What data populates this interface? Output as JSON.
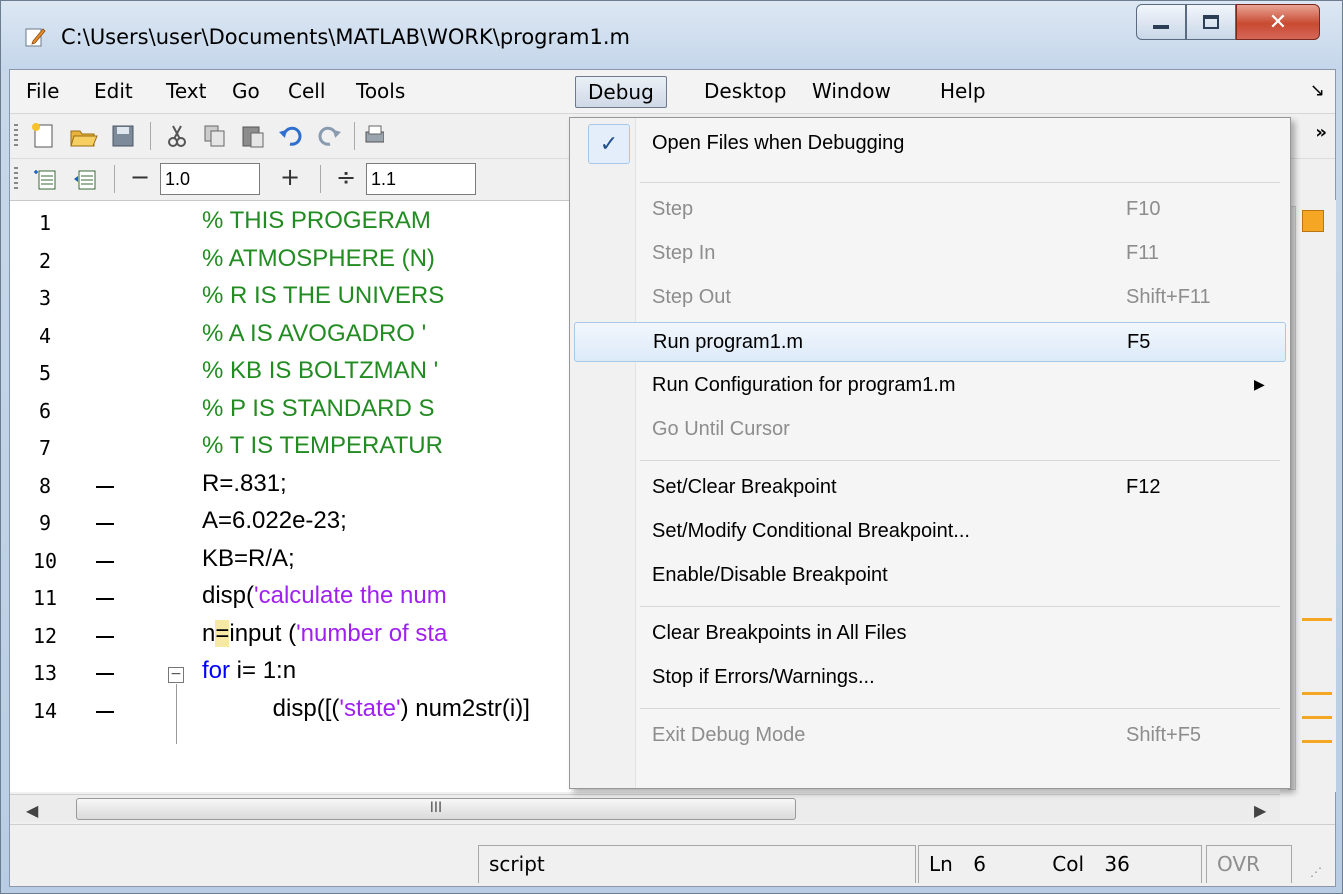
{
  "window": {
    "title": "C:\\Users\\user\\Documents\\MATLAB\\WORK\\program1.m"
  },
  "menubar": {
    "items": [
      "File",
      "Edit",
      "Text",
      "Go",
      "Cell",
      "Tools",
      "Debug",
      "Desktop",
      "Window",
      "Help"
    ],
    "open_menu": "Debug"
  },
  "toolbar2": {
    "value1": "1.0",
    "value2": "1.1"
  },
  "editor": {
    "lines": [
      {
        "num": "1",
        "dash": false,
        "segments": [
          {
            "t": "% THIS PROGERAM ",
            "c": "comment"
          }
        ]
      },
      {
        "num": "2",
        "dash": false,
        "segments": [
          {
            "t": "% ATMOSPHERE (N)",
            "c": "comment"
          }
        ]
      },
      {
        "num": "3",
        "dash": false,
        "segments": [
          {
            "t": "% R IS THE UNIVERS",
            "c": "comment"
          }
        ]
      },
      {
        "num": "4",
        "dash": false,
        "segments": [
          {
            "t": "% A IS AVOGADRO '",
            "c": "comment"
          }
        ]
      },
      {
        "num": "5",
        "dash": false,
        "segments": [
          {
            "t": "% KB IS BOLTZMAN '",
            "c": "comment"
          }
        ]
      },
      {
        "num": "6",
        "dash": false,
        "segments": [
          {
            "t": "% P IS STANDARD S",
            "c": "comment"
          }
        ]
      },
      {
        "num": "7",
        "dash": false,
        "segments": [
          {
            "t": "% T IS TEMPERATUR",
            "c": "comment"
          }
        ]
      },
      {
        "num": "8",
        "dash": true,
        "segments": [
          {
            "t": "R=.831;",
            "c": "normal"
          }
        ]
      },
      {
        "num": "9",
        "dash": true,
        "segments": [
          {
            "t": "A=6.022e-23;",
            "c": "normal"
          }
        ]
      },
      {
        "num": "10",
        "dash": true,
        "segments": [
          {
            "t": "KB=R/A;",
            "c": "normal"
          }
        ]
      },
      {
        "num": "11",
        "dash": true,
        "segments": [
          {
            "t": "disp(",
            "c": "normal"
          },
          {
            "t": "'calculate the num",
            "c": "string"
          }
        ]
      },
      {
        "num": "12",
        "dash": true,
        "segments": [
          {
            "t": "n",
            "c": "normal"
          },
          {
            "t": "=",
            "c": "cursor"
          },
          {
            "t": "input (",
            "c": "normal"
          },
          {
            "t": "'number of sta",
            "c": "string"
          }
        ]
      },
      {
        "num": "13",
        "dash": true,
        "segments": [
          {
            "t": "for",
            "c": "keyword"
          },
          {
            "t": " i= 1:n",
            "c": "normal"
          }
        ]
      },
      {
        "num": "14",
        "dash": true,
        "segments": [
          {
            "t": "    disp([(",
            "c": "normal"
          },
          {
            "t": "'state'",
            "c": "string"
          },
          {
            "t": ") num2str(i)]",
            "c": "normal"
          }
        ]
      }
    ]
  },
  "hscroll": {
    "thumb_grip": "III"
  },
  "statusbar": {
    "mode": "script",
    "ln_label": "Ln",
    "ln_value": "6",
    "col_label": "Col",
    "col_value": "36",
    "ovr": "OVR"
  },
  "debug_menu": {
    "items": [
      {
        "type": "item",
        "label": "Open Files when Debugging",
        "shortcut": "",
        "disabled": false,
        "checked": true
      },
      {
        "type": "sep"
      },
      {
        "type": "item",
        "label": "Step",
        "shortcut": "F10",
        "disabled": true
      },
      {
        "type": "item",
        "label": "Step In",
        "shortcut": "F11",
        "disabled": true
      },
      {
        "type": "item",
        "label": "Step Out",
        "shortcut": "Shift+F11",
        "disabled": true
      },
      {
        "type": "item",
        "label": "Run program1.m",
        "shortcut": "F5",
        "disabled": false,
        "highlighted": true
      },
      {
        "type": "item",
        "label": "Run Configuration for program1.m",
        "shortcut": "",
        "disabled": false,
        "submenu": true
      },
      {
        "type": "item",
        "label": "Go Until Cursor",
        "shortcut": "",
        "disabled": true
      },
      {
        "type": "sep"
      },
      {
        "type": "item",
        "label": "Set/Clear Breakpoint",
        "shortcut": "F12",
        "disabled": false
      },
      {
        "type": "item",
        "label": "Set/Modify Conditional Breakpoint...",
        "shortcut": "",
        "disabled": false
      },
      {
        "type": "item",
        "label": "Enable/Disable Breakpoint",
        "shortcut": "",
        "disabled": false
      },
      {
        "type": "sep"
      },
      {
        "type": "item",
        "label": "Clear Breakpoints in All Files",
        "shortcut": "",
        "disabled": false
      },
      {
        "type": "item",
        "label": "Stop if Errors/Warnings...",
        "shortcut": "",
        "disabled": false
      },
      {
        "type": "sep"
      },
      {
        "type": "item",
        "label": "Exit Debug Mode",
        "shortcut": "Shift+F5",
        "disabled": true
      }
    ]
  },
  "colors": {
    "comment": "#228b22",
    "string": "#a020f0",
    "keyword": "#0000ff",
    "warning_marker": "#f5a623"
  }
}
